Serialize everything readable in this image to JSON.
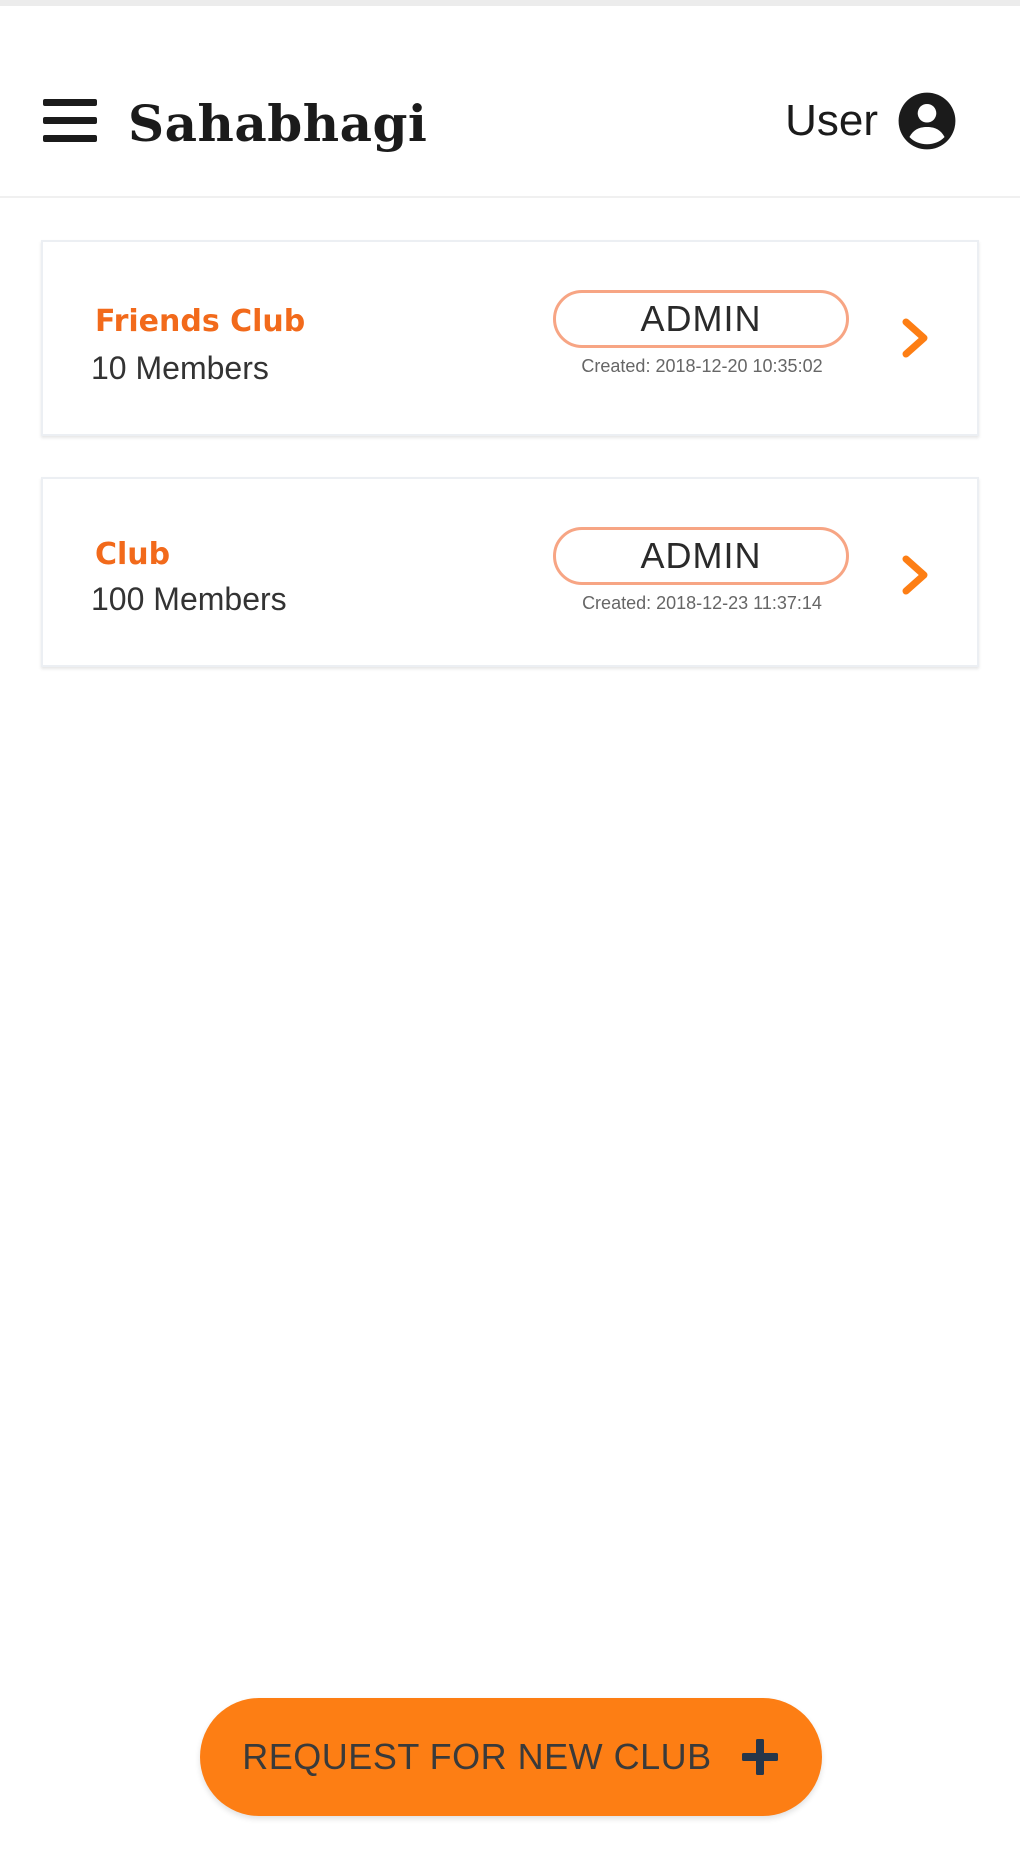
{
  "app_bar": {
    "title": "Sahabhagi",
    "user_label": "User",
    "menu_icon": "hamburger-menu-icon",
    "user_icon": "account-circle-icon"
  },
  "clubs": [
    {
      "name": "Friends Club",
      "members": "10 Members",
      "role": "ADMIN",
      "created": "Created: 2018-12-20 10:35:02"
    },
    {
      "name": "Club",
      "members": "100 Members",
      "role": "ADMIN",
      "created": "Created: 2018-12-23 11:37:14"
    }
  ],
  "fab": {
    "label": "REQUEST FOR NEW CLUB",
    "icon": "plus-icon"
  },
  "colors": {
    "accent": "#fd7e14",
    "club_name": "#f26a1b",
    "badge_border": "#f7a584",
    "text_dark": "#1b1b1b"
  }
}
